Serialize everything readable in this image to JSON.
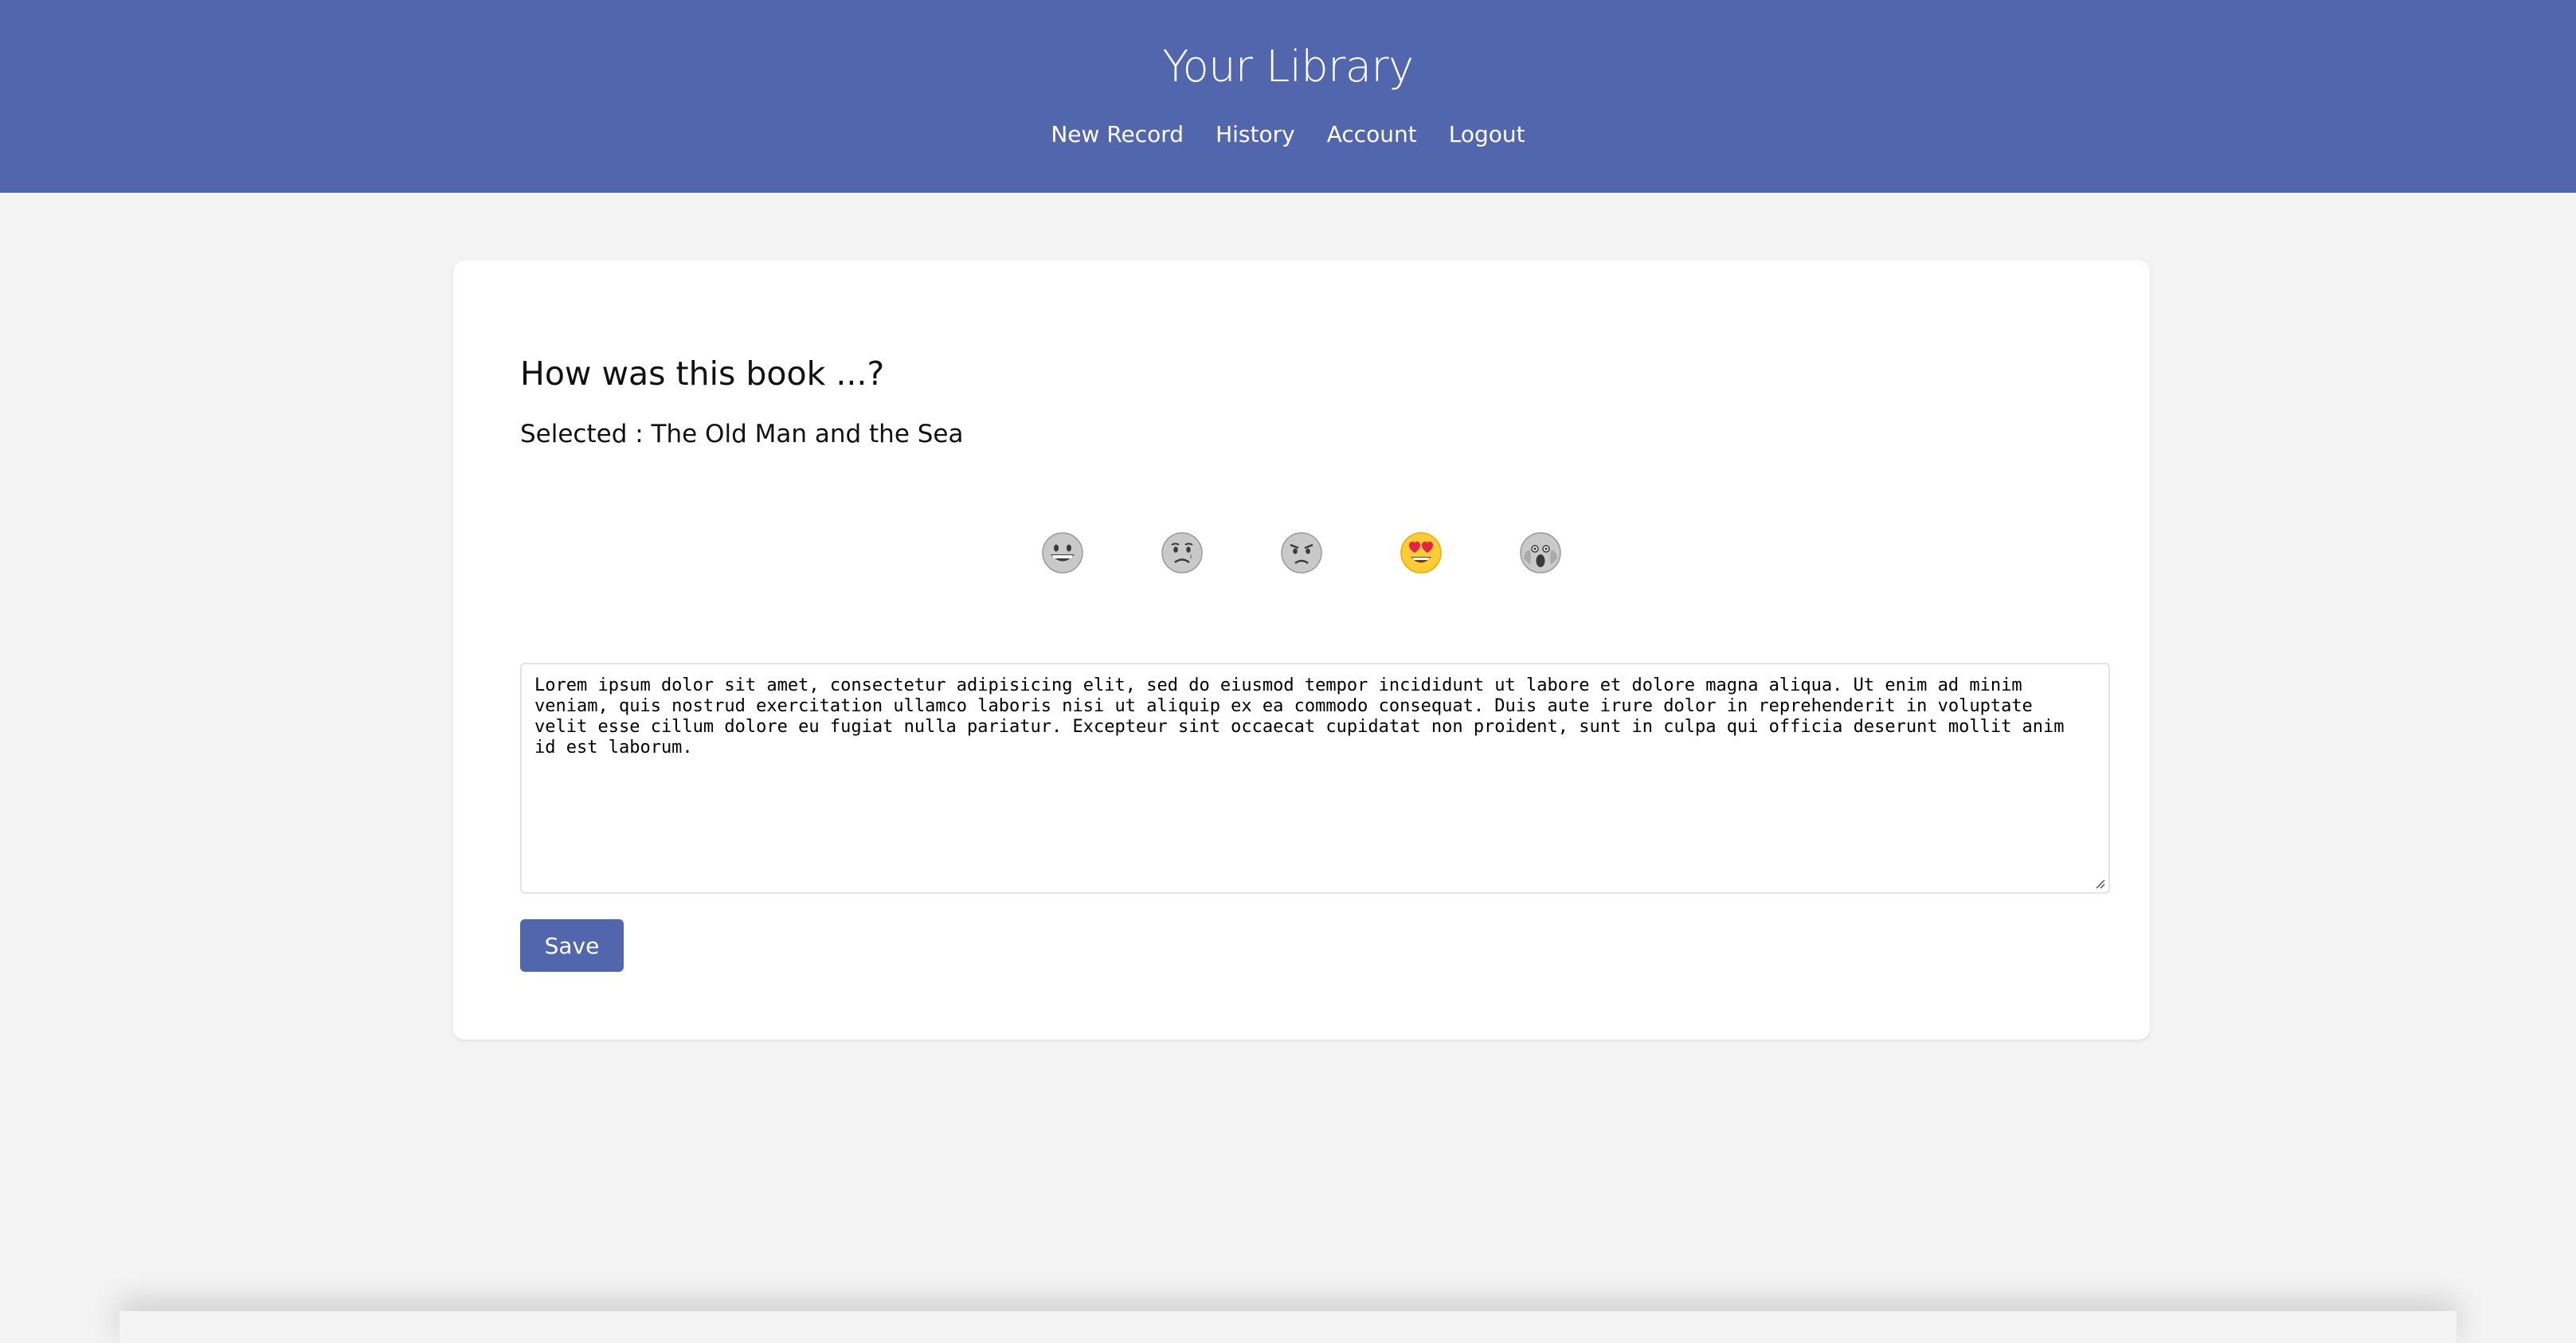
{
  "header": {
    "title": "Your Library",
    "nav": [
      {
        "label": "New Record"
      },
      {
        "label": "History"
      },
      {
        "label": "Account"
      },
      {
        "label": "Logout"
      }
    ],
    "background_color": "#5166ad"
  },
  "card": {
    "question": "How was this book ...?",
    "selected_prefix": "Selected : ",
    "selected_book": "The Old Man and the Sea"
  },
  "emojis": [
    {
      "name": "grinning-face-icon",
      "selected": false
    },
    {
      "name": "crying-face-icon",
      "selected": false
    },
    {
      "name": "angry-face-icon",
      "selected": false
    },
    {
      "name": "heart-eyes-face-icon",
      "selected": true
    },
    {
      "name": "screaming-face-icon",
      "selected": false
    }
  ],
  "review": {
    "text": "Lorem ipsum dolor sit amet, consectetur adipisicing elit, sed do eiusmod tempor incididunt ut labore et dolore magna aliqua. Ut enim ad minim veniam, quis nostrud exercitation ullamco laboris nisi ut aliquip ex ea commodo consequat. Duis aute irure dolor in reprehenderit in voluptate velit esse cillum dolore eu fugiat nulla pariatur. Excepteur sint occaecat cupidatat non proident, sunt in culpa qui officia deserunt mollit anim id est laborum."
  },
  "actions": {
    "save_label": "Save"
  }
}
